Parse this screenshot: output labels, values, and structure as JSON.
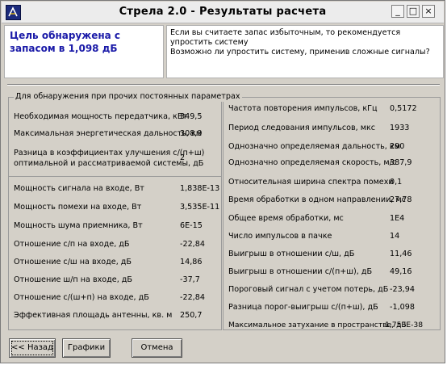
{
  "window": {
    "title": "Стрела 2.0 - Результаты расчета"
  },
  "header": {
    "status": "Цель обнаружена с запасом в 1,098 дБ",
    "advice": "Если вы считаете запас избыточным, то рекомендуется упростить систему\nВозможно ли упростить систему, применив сложные сигналы?"
  },
  "left_group": {
    "caption": "Для обнаружения при прочих постоянных параметрах",
    "top_rows": [
      {
        "label": "Необходимая мощность передатчика, кВт",
        "value": "349,5"
      },
      {
        "label": "Максимальная энергетическая дальность, км",
        "value": "308,9"
      },
      {
        "label": "Разница в коэффициентах улучшения с/(п+ш)\nоптимальной и рассматриваемой системы, дБ",
        "value": "2"
      }
    ],
    "bottom_rows": [
      {
        "label": "Мощность сигнала на входе, Вт",
        "value": "1,838E-13"
      },
      {
        "label": "Мощность помехи на входе, Вт",
        "value": "3,535E-11"
      },
      {
        "label": "Мощность шума приемника, Вт",
        "value": "6E-15"
      },
      {
        "label": "Отношение с/п на входе, дБ",
        "value": "-22,84"
      },
      {
        "label": "Отношение с/ш на входе, дБ",
        "value": "14,86"
      },
      {
        "label": "Отношение ш/п на входе, дБ",
        "value": "-37,7"
      },
      {
        "label": "Отношение с/(ш+п) на входе, дБ",
        "value": "-22,84"
      },
      {
        "label": "Эффективная площадь антенны, кв. м",
        "value": "250,7"
      }
    ]
  },
  "right_group": {
    "rows": [
      {
        "label": "Частота повторения импульсов, кГц",
        "value": "0,5172"
      },
      {
        "label": "Период следования импульсов, мкс",
        "value": "1933"
      },
      {
        "label": "Однозначно определяемая дальность, км",
        "value": "290"
      },
      {
        "label": "Однозначно определяемая скорость, м/с",
        "value": "387,9"
      },
      {
        "label": "Относительная ширина спектра помехи",
        "value": "0,1"
      },
      {
        "label": "Время обработки в одном направлении, мс",
        "value": "27,78"
      },
      {
        "label": "Общее время обработки,  мс",
        "value": "1E4"
      },
      {
        "label": "Число импульсов в пачке",
        "value": "14"
      },
      {
        "label": "Выигрыш в отношении с/ш, дБ",
        "value": "11,46"
      },
      {
        "label": "Выигрыш в отношении с/(п+ш), дБ",
        "value": "49,16"
      },
      {
        "label": "Пороговый сигнал с учетом потерь, дБ",
        "value": "-23,94"
      },
      {
        "label": "Разница порог-выигрыш с/(п+ш), дБ",
        "value": "-1,098"
      },
      {
        "label": "Максимальное затухание в пространстве, дБ",
        "value": "1,753E-38"
      }
    ]
  },
  "buttons": {
    "back": "<< Назад",
    "graphs": "Графики",
    "cancel": "Отмена"
  },
  "titlebar_buttons": {
    "minimize": "_",
    "maximize": "□",
    "close": "×"
  }
}
